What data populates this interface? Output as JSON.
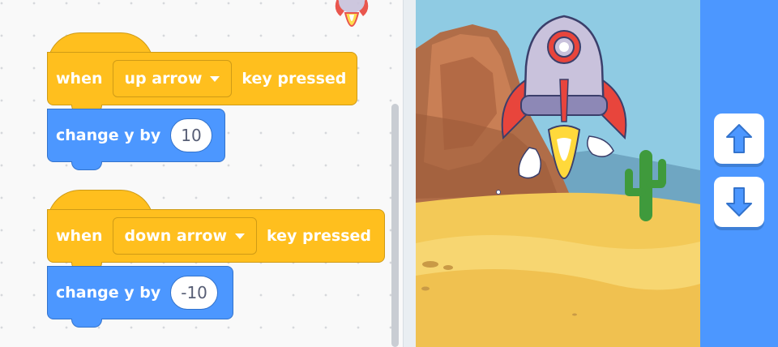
{
  "scripts": [
    {
      "hat": {
        "prefix": "when",
        "key_option": "up arrow",
        "suffix": "key pressed"
      },
      "command": {
        "label": "change y by",
        "value": "10"
      }
    },
    {
      "hat": {
        "prefix": "when",
        "key_option": "down arrow",
        "suffix": "key pressed"
      },
      "command": {
        "label": "change y by",
        "value": "-10"
      }
    }
  ],
  "stage": {
    "sprite": "rocketship",
    "backdrop": "desert"
  },
  "controls": {
    "up_icon": "up-arrow-icon",
    "down_icon": "down-arrow-icon"
  },
  "colors": {
    "events": "#ffbf1e",
    "motion": "#4c97ff",
    "panel": "#4c97ff",
    "sky": "#8fcbe3",
    "sand": "#f3c957"
  }
}
